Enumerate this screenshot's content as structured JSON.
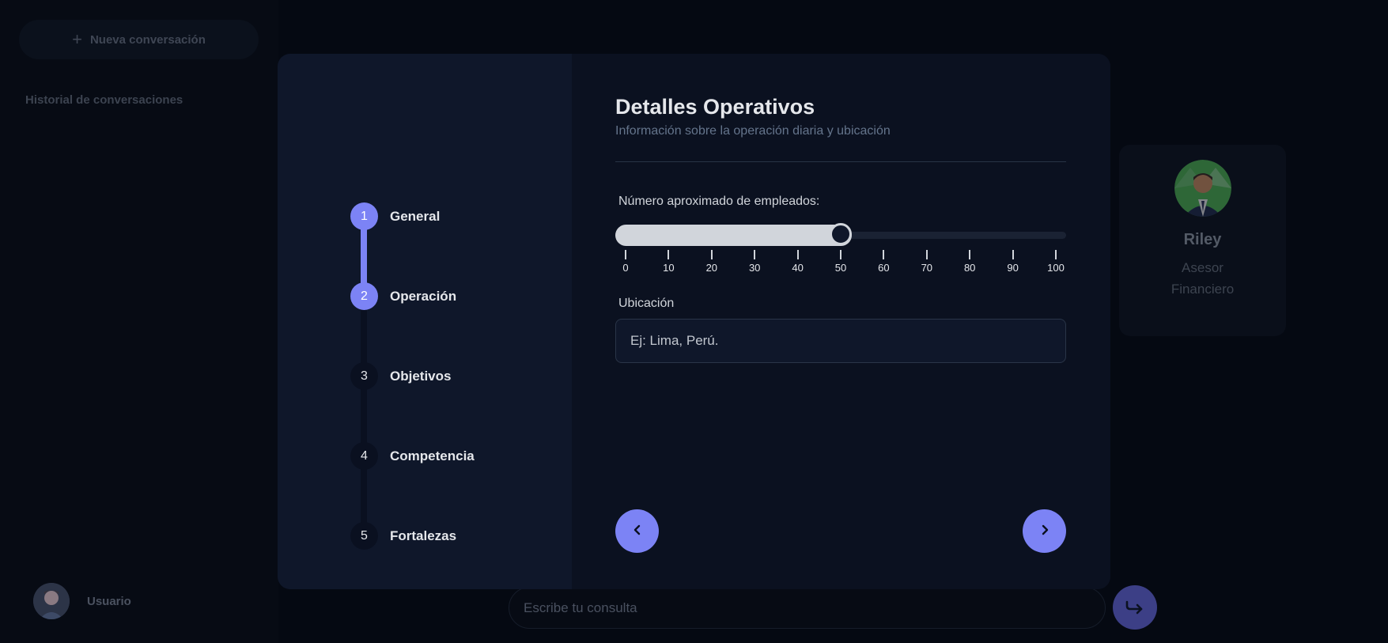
{
  "sidebar": {
    "new_chat_label": "Nueva conversación",
    "history_title": "Historial de conversaciones",
    "user_name": "Usuario"
  },
  "advisor": {
    "name": "Riley",
    "role_line1": "Asesor",
    "role_line2": "Financiero"
  },
  "chat": {
    "placeholder": "Escribe tu consulta"
  },
  "modal": {
    "steps": [
      {
        "number": "1",
        "label": "General",
        "state": "completed"
      },
      {
        "number": "2",
        "label": "Operación",
        "state": "current"
      },
      {
        "number": "3",
        "label": "Objetivos",
        "state": "pending"
      },
      {
        "number": "4",
        "label": "Competencia",
        "state": "pending"
      },
      {
        "number": "5",
        "label": "Fortalezas",
        "state": "pending"
      }
    ],
    "title": "Detalles Operativos",
    "subtitle": "Información sobre la operación diaria y ubicación",
    "employees": {
      "label": "Número aproximado de empleados:",
      "value": 50,
      "min": 0,
      "max": 100,
      "ticks": [
        "0",
        "10",
        "20",
        "30",
        "40",
        "50",
        "60",
        "70",
        "80",
        "90",
        "100"
      ]
    },
    "location": {
      "label": "Ubicación",
      "placeholder": "Ej: Lima, Perú."
    }
  },
  "colors": {
    "accent": "#7c83f5",
    "background": "#050912",
    "modal_steps_bg": "#0f172a",
    "modal_form_bg": "#0b1120",
    "slider_fill": "#d1d5db"
  },
  "icons": {
    "prev": "chevron-left-icon",
    "next": "chevron-right-icon",
    "send": "send-arrow-icon",
    "new_chat": "plus-icon"
  }
}
